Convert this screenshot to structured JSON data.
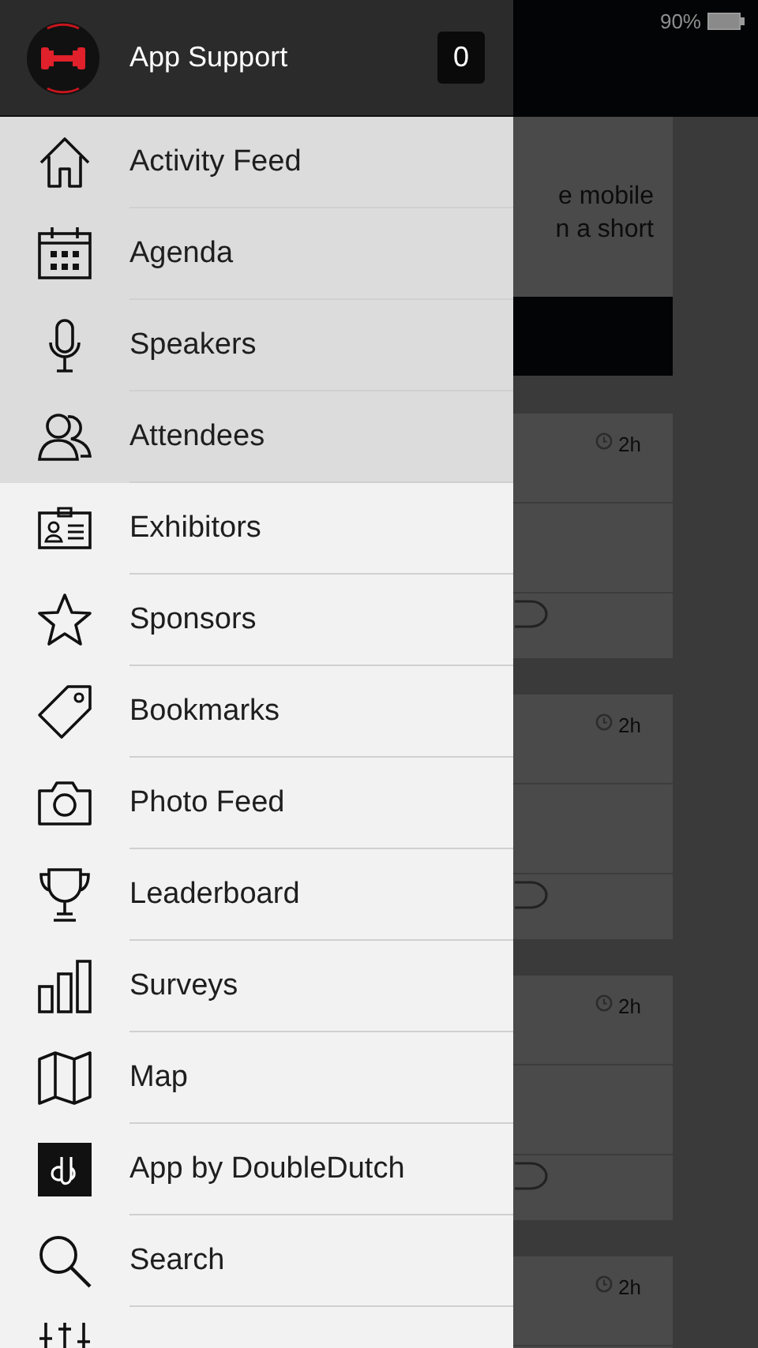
{
  "status_bar": {
    "battery": "90%"
  },
  "drawer": {
    "header": {
      "title": "App Support",
      "count": "0"
    },
    "items": [
      {
        "label": "Activity Feed"
      },
      {
        "label": "Agenda"
      },
      {
        "label": "Speakers"
      },
      {
        "label": "Attendees"
      },
      {
        "label": "Exhibitors"
      },
      {
        "label": "Sponsors"
      },
      {
        "label": "Bookmarks"
      },
      {
        "label": "Photo Feed"
      },
      {
        "label": "Leaderboard"
      },
      {
        "label": "Surveys"
      },
      {
        "label": "Map"
      },
      {
        "label": "App by DoubleDutch"
      },
      {
        "label": "Search"
      }
    ]
  },
  "feed": {
    "intro": [
      "e mobile",
      "n a short"
    ],
    "posts": [
      {
        "time": "2h"
      },
      {
        "time": "2h"
      },
      {
        "time": "2h"
      },
      {
        "time": "2h"
      }
    ]
  }
}
